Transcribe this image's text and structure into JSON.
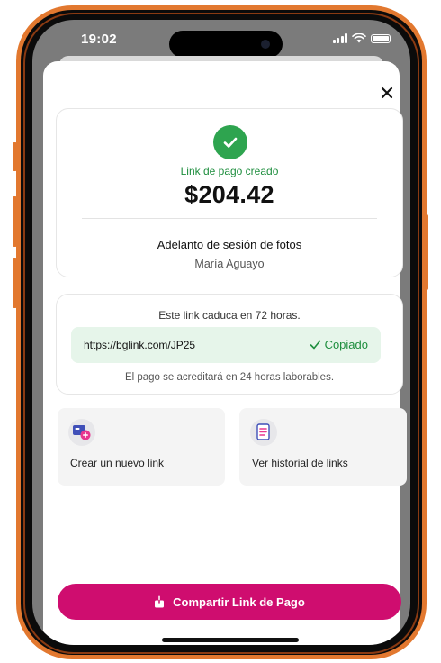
{
  "status_bar": {
    "time": "19:02",
    "icons": [
      "signal-icon",
      "wifi-icon",
      "battery-icon"
    ]
  },
  "sheet": {
    "close_icon": "close-icon"
  },
  "summary": {
    "status_icon": "check-circle-icon",
    "status_label": "Link de pago creado",
    "amount": "$204.42",
    "concept": "Adelanto de sesión de fotos",
    "client_name": "María Aguayo"
  },
  "link_card": {
    "expiry_text": "Este link caduca en 72 horas.",
    "url": "https://bglink.com/JP25",
    "copied_label": "Copiado",
    "copied_icon": "checkmark-icon",
    "accreditation_text": "El pago se acreditará en 24 horas laborables."
  },
  "actions": [
    {
      "label": "Crear un nuevo link",
      "icon": "new-link-icon"
    },
    {
      "label": "Ver historial de links",
      "icon": "history-document-icon"
    }
  ],
  "cta": {
    "label": "Compartir Link de Pago",
    "icon": "share-icon"
  },
  "colors": {
    "frame_accent": "#e2782f",
    "success": "#2ea44f",
    "success_text": "#1e8e3e",
    "copied_bg": "#e6f5ea",
    "cta": "#cf0d6f"
  }
}
